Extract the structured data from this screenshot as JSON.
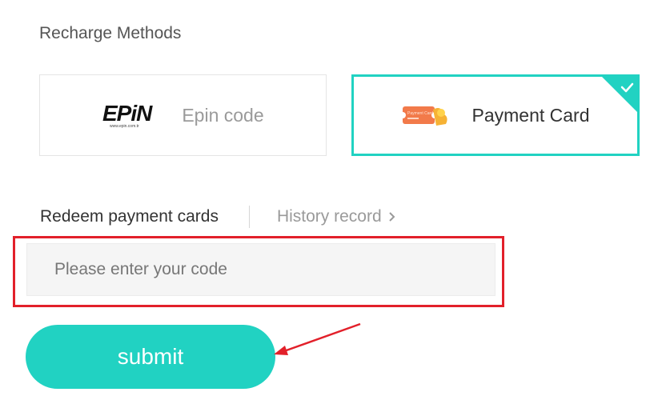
{
  "recharge": {
    "title": "Recharge Methods",
    "methods": [
      {
        "label": "Epin code",
        "logo": "epin-logo",
        "selected": false
      },
      {
        "label": "Payment Card",
        "icon": "payment-card-icon",
        "selected": true
      }
    ]
  },
  "tabs": {
    "redeem_label": "Redeem payment cards",
    "history_label": "History record"
  },
  "code_input": {
    "placeholder": "Please enter your code",
    "value": ""
  },
  "submit_label": "submit",
  "colors": {
    "accent": "#21d2c2",
    "annotation": "#e2202a"
  },
  "epin_logo": {
    "text": "EPiN",
    "subtext": "www.epin.com.tr"
  },
  "card_icon_text": "Payment Card"
}
